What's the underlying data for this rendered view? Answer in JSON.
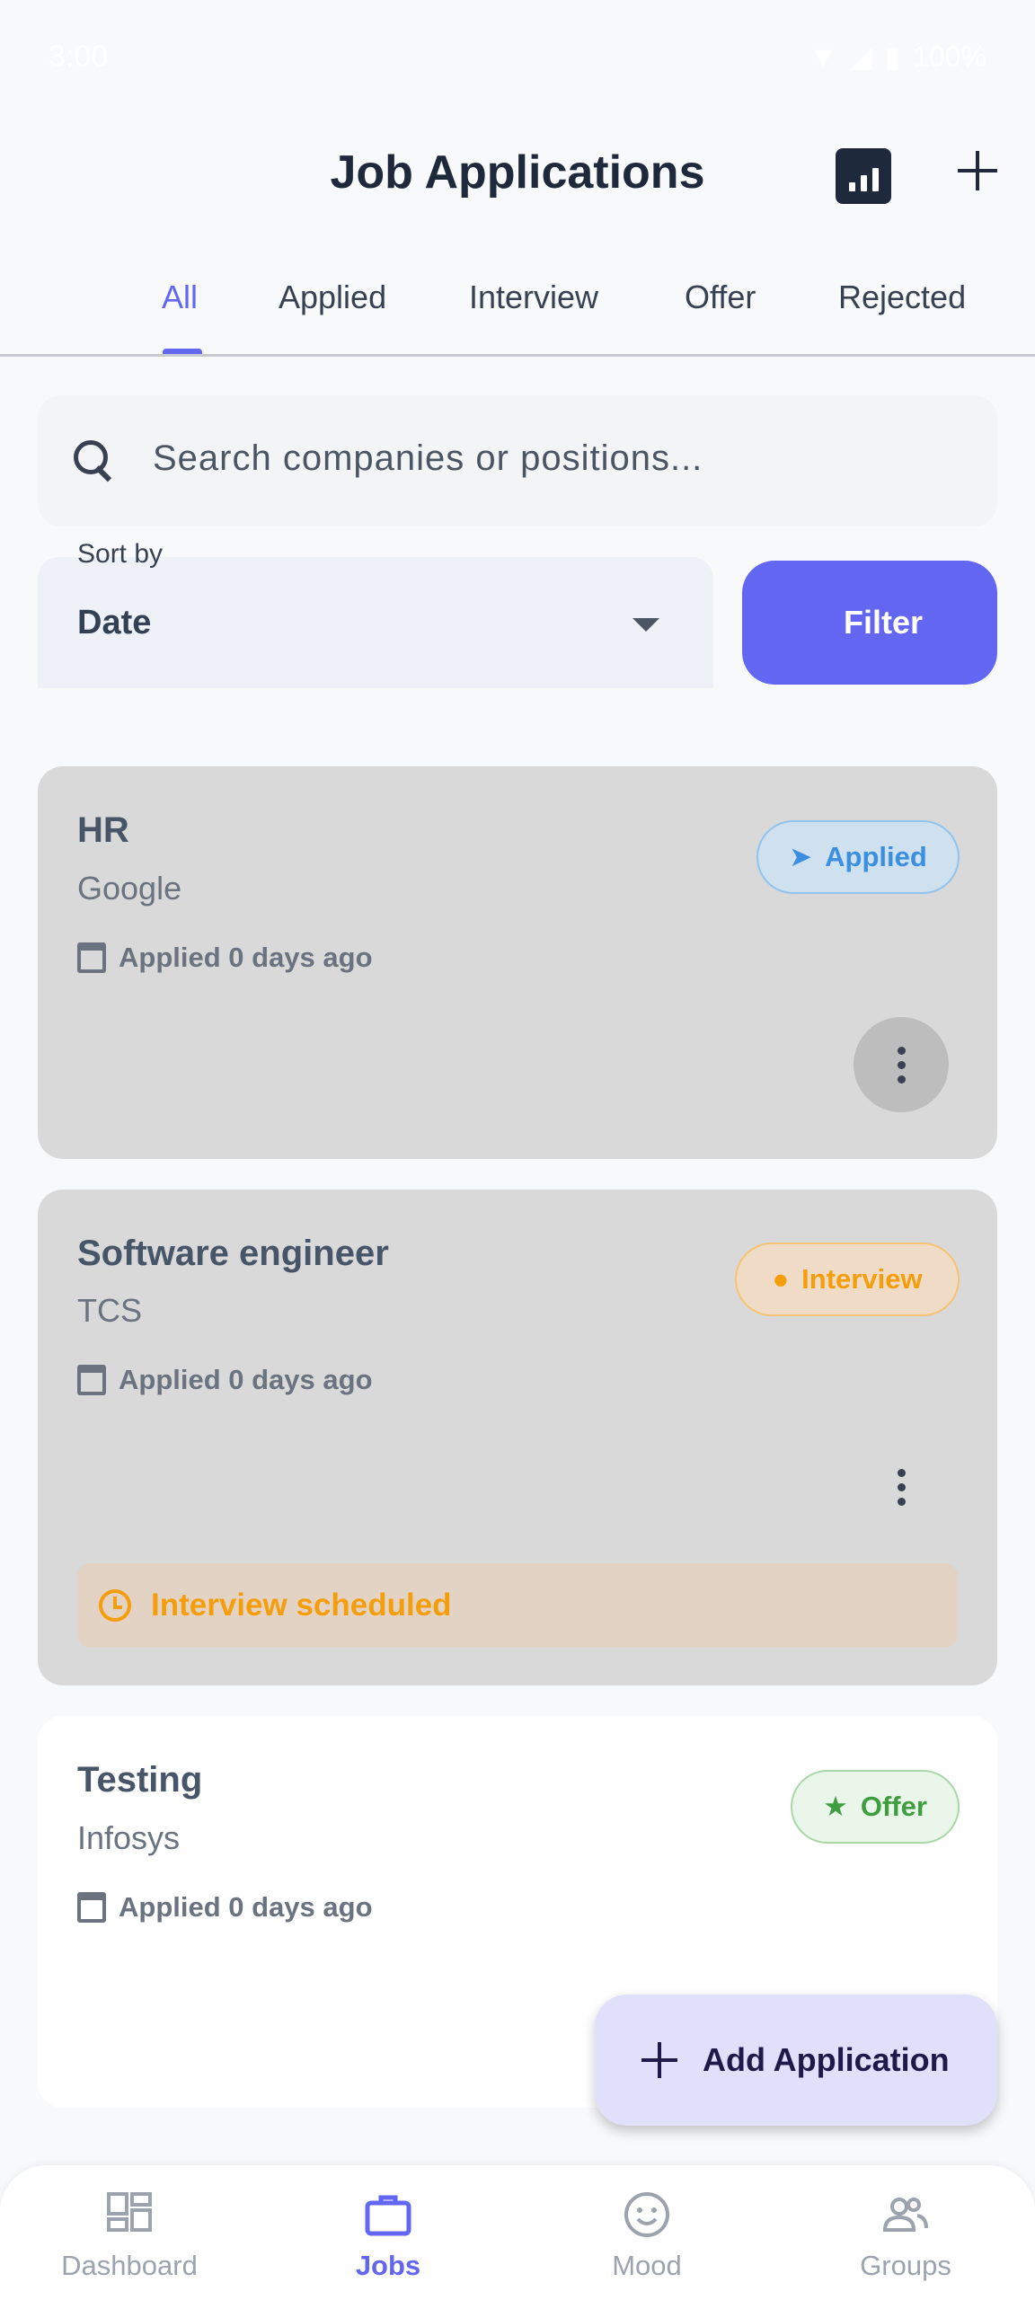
{
  "status_bar": {
    "time": "3:00",
    "battery": "100%"
  },
  "header": {
    "title": "Job Applications",
    "stats_icon": "bar-chart-icon",
    "add_icon": "plus-icon"
  },
  "tabs": [
    {
      "label": "All",
      "active": true
    },
    {
      "label": "Applied",
      "active": false
    },
    {
      "label": "Interview",
      "active": false
    },
    {
      "label": "Offer",
      "active": false
    },
    {
      "label": "Rejected",
      "active": false
    }
  ],
  "search": {
    "placeholder": "Search companies or positions..."
  },
  "sort": {
    "label": "Sort by",
    "value": "Date"
  },
  "filter_button": "Filter",
  "applications": [
    {
      "title": "HR",
      "company": "Google",
      "applied": "Applied 0 days ago",
      "status": "Applied",
      "status_icon": "send-icon"
    },
    {
      "title": "Software engineer",
      "company": "TCS",
      "applied": "Applied 0 days ago",
      "status": "Interview",
      "status_icon": "person-icon",
      "note": "Interview scheduled"
    },
    {
      "title": "Testing",
      "company": "Infosys",
      "applied": "Applied 0 days ago",
      "status": "Offer",
      "status_icon": "star-icon"
    }
  ],
  "fab": {
    "label": "Add Application"
  },
  "bottom_nav": [
    {
      "label": "Dashboard",
      "icon": "dashboard-icon",
      "active": false
    },
    {
      "label": "Jobs",
      "icon": "briefcase-icon",
      "active": true
    },
    {
      "label": "Mood",
      "icon": "smiley-icon",
      "active": false
    },
    {
      "label": "Groups",
      "icon": "people-icon",
      "active": false
    }
  ],
  "colors": {
    "accent": "#6366f1",
    "applied": "#3b8fe0",
    "interview": "#f59e0b",
    "offer": "#3f9e3f"
  }
}
